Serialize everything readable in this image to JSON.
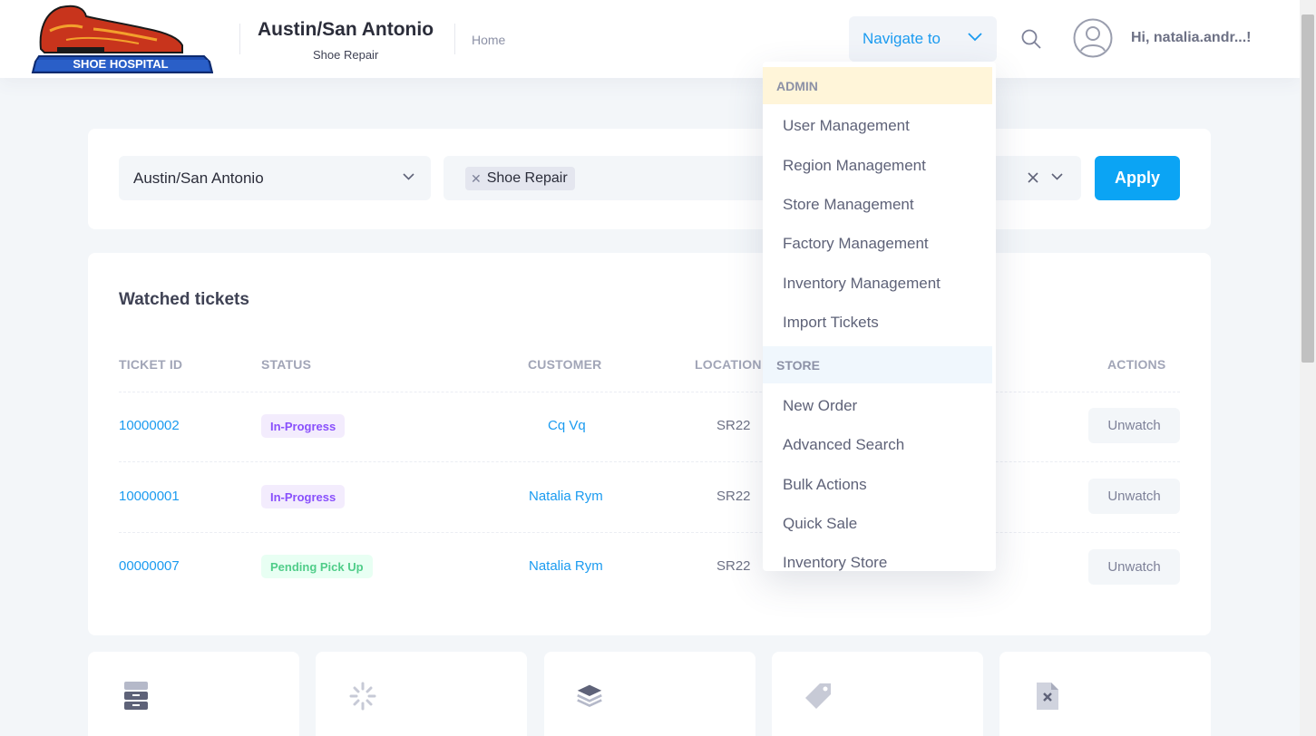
{
  "header": {
    "logo_text": "SHOE HOSPITAL",
    "brand_title": "Austin/San Antonio",
    "brand_subtitle": "Shoe Repair",
    "home_link": "Home",
    "navigate_label": "Navigate to",
    "greeting": "Hi, natalia.andr...!"
  },
  "filters": {
    "region_value": "Austin/San Antonio",
    "type_tag": "Shoe Repair",
    "apply_label": "Apply"
  },
  "watched": {
    "title": "Watched tickets",
    "columns": {
      "ticket_id": "TICKET ID",
      "status": "STATUS",
      "customer": "CUSTOMER",
      "location": "LOCATION",
      "actions": "ACTIONS"
    },
    "rows": [
      {
        "ticket_id": "10000002",
        "status": "In-Progress",
        "customer": "Cq Vq",
        "location": "SR22",
        "action": "Unwatch"
      },
      {
        "ticket_id": "10000001",
        "status": "In-Progress",
        "customer": "Natalia Rym",
        "location": "SR22",
        "action": "Unwatch"
      },
      {
        "ticket_id": "00000007",
        "status": "Pending Pick Up",
        "customer": "Natalia Rym",
        "location": "SR22",
        "action": "Unwatch"
      }
    ]
  },
  "menu": {
    "admin_header": "ADMIN",
    "admin_items": [
      "User Management",
      "Region Management",
      "Store Management",
      "Factory Management",
      "Inventory Management",
      "Import Tickets"
    ],
    "store_header": "STORE",
    "store_items": [
      "New Order",
      "Advanced Search",
      "Bulk Actions",
      "Quick Sale",
      "Inventory Store"
    ]
  },
  "tiles": [
    "archive-drawers-icon",
    "loading-spinner-icon",
    "layers-stack-icon",
    "price-tag-icon",
    "file-delete-icon"
  ],
  "colors": {
    "accent": "#1b9bf0",
    "apply_button": "#0ba4f4",
    "in_progress": "#8950fc",
    "pending": "#50cd89",
    "admin_header_bg": "#fff5d9"
  }
}
